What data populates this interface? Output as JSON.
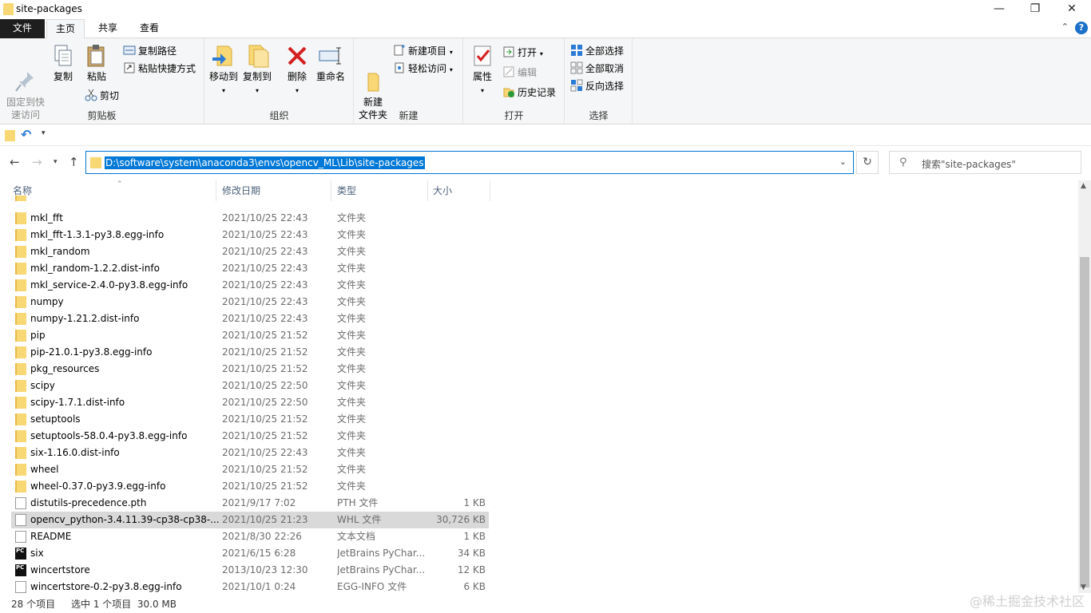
{
  "window": {
    "title": "site-packages"
  },
  "tabs": [
    "文件",
    "主页",
    "共享",
    "查看"
  ],
  "ribbon": {
    "clipboard": {
      "pin": "固定到快\n速访问",
      "copy": "复制",
      "paste": "粘贴",
      "copy_path": "复制路径",
      "paste_shortcut": "粘贴快捷方式",
      "cut": "剪切",
      "label": "剪贴板"
    },
    "organize": {
      "move_to": "移动到",
      "copy_to": "复制到",
      "delete": "删除",
      "rename": "重命名",
      "label": "组织"
    },
    "new": {
      "new_folder": "新建\n文件夹",
      "new_item": "新建项目",
      "easy_access": "轻松访问",
      "label": "新建"
    },
    "open": {
      "properties": "属性",
      "open": "打开",
      "edit": "编辑",
      "history": "历史记录",
      "label": "打开"
    },
    "select": {
      "select_all": "全部选择",
      "select_none": "全部取消",
      "invert": "反向选择",
      "label": "选择"
    }
  },
  "address": {
    "path": "D:\\software\\system\\anaconda3\\envs\\opencv_ML\\Lib\\site-packages",
    "search_placeholder": "搜索\"site-packages\""
  },
  "columns": {
    "name": "名称",
    "date": "修改日期",
    "type": "类型",
    "size": "大小"
  },
  "files": [
    {
      "name": "mkl_fft",
      "date": "2021/10/25 22:43",
      "type": "文件夹",
      "size": "",
      "kind": "folder"
    },
    {
      "name": "mkl_fft-1.3.1-py3.8.egg-info",
      "date": "2021/10/25 22:43",
      "type": "文件夹",
      "size": "",
      "kind": "folder"
    },
    {
      "name": "mkl_random",
      "date": "2021/10/25 22:43",
      "type": "文件夹",
      "size": "",
      "kind": "folder"
    },
    {
      "name": "mkl_random-1.2.2.dist-info",
      "date": "2021/10/25 22:43",
      "type": "文件夹",
      "size": "",
      "kind": "folder"
    },
    {
      "name": "mkl_service-2.4.0-py3.8.egg-info",
      "date": "2021/10/25 22:43",
      "type": "文件夹",
      "size": "",
      "kind": "folder"
    },
    {
      "name": "numpy",
      "date": "2021/10/25 22:43",
      "type": "文件夹",
      "size": "",
      "kind": "folder"
    },
    {
      "name": "numpy-1.21.2.dist-info",
      "date": "2021/10/25 22:43",
      "type": "文件夹",
      "size": "",
      "kind": "folder"
    },
    {
      "name": "pip",
      "date": "2021/10/25 21:52",
      "type": "文件夹",
      "size": "",
      "kind": "folder"
    },
    {
      "name": "pip-21.0.1-py3.8.egg-info",
      "date": "2021/10/25 21:52",
      "type": "文件夹",
      "size": "",
      "kind": "folder"
    },
    {
      "name": "pkg_resources",
      "date": "2021/10/25 21:52",
      "type": "文件夹",
      "size": "",
      "kind": "folder"
    },
    {
      "name": "scipy",
      "date": "2021/10/25 22:50",
      "type": "文件夹",
      "size": "",
      "kind": "folder"
    },
    {
      "name": "scipy-1.7.1.dist-info",
      "date": "2021/10/25 22:50",
      "type": "文件夹",
      "size": "",
      "kind": "folder"
    },
    {
      "name": "setuptools",
      "date": "2021/10/25 21:52",
      "type": "文件夹",
      "size": "",
      "kind": "folder"
    },
    {
      "name": "setuptools-58.0.4-py3.8.egg-info",
      "date": "2021/10/25 21:52",
      "type": "文件夹",
      "size": "",
      "kind": "folder"
    },
    {
      "name": "six-1.16.0.dist-info",
      "date": "2021/10/25 22:43",
      "type": "文件夹",
      "size": "",
      "kind": "folder"
    },
    {
      "name": "wheel",
      "date": "2021/10/25 21:52",
      "type": "文件夹",
      "size": "",
      "kind": "folder"
    },
    {
      "name": "wheel-0.37.0-py3.9.egg-info",
      "date": "2021/10/25 21:52",
      "type": "文件夹",
      "size": "",
      "kind": "folder"
    },
    {
      "name": "distutils-precedence.pth",
      "date": "2021/9/17 7:02",
      "type": "PTH 文件",
      "size": "1 KB",
      "kind": "file"
    },
    {
      "name": "opencv_python-3.4.11.39-cp38-cp38-...",
      "date": "2021/10/25 21:23",
      "type": "WHL 文件",
      "size": "30,726 KB",
      "kind": "file",
      "selected": true
    },
    {
      "name": "README",
      "date": "2021/8/30 22:26",
      "type": "文本文档",
      "size": "1 KB",
      "kind": "file"
    },
    {
      "name": "six",
      "date": "2021/6/15 6:28",
      "type": "JetBrains PyChar...",
      "size": "34 KB",
      "kind": "pycharm"
    },
    {
      "name": "wincertstore",
      "date": "2013/10/23 12:30",
      "type": "JetBrains PyChar...",
      "size": "12 KB",
      "kind": "pycharm"
    },
    {
      "name": "wincertstore-0.2-py3.8.egg-info",
      "date": "2021/10/1 0:24",
      "type": "EGG-INFO 文件",
      "size": "6 KB",
      "kind": "file"
    }
  ],
  "status": {
    "count": "28 个项目",
    "selection": "选中 1 个项目  30.0 MB"
  },
  "watermark": "@稀土掘金技术社区"
}
